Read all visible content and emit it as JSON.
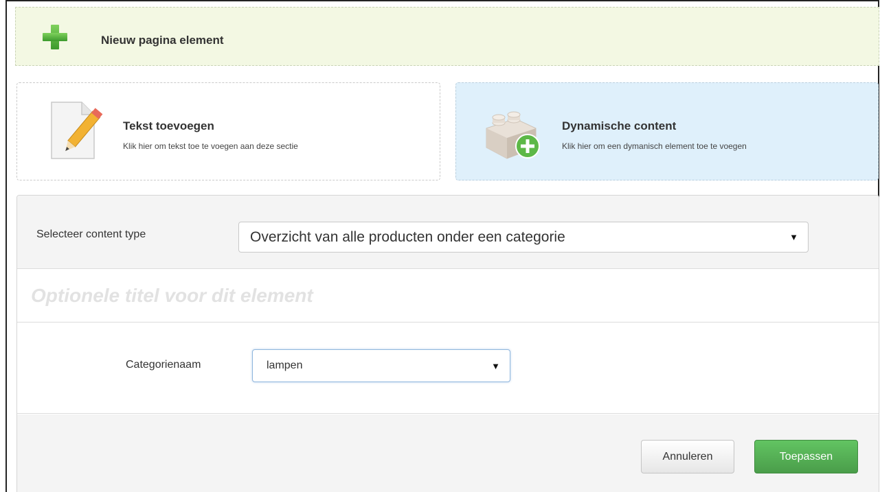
{
  "header": {
    "title": "Nieuw pagina element",
    "icon": "plus-icon",
    "accent": "#4caf3b"
  },
  "cards": {
    "text": {
      "title": "Tekst toevoegen",
      "description": "Klik hier om tekst toe te voegen aan deze sectie",
      "icon": "pencil-document-icon"
    },
    "dynamic": {
      "title": "Dynamische content",
      "description": "Klik hier om een dymanisch element toe te voegen",
      "icon": "lego-brick-add-icon",
      "selected_background": "#dff0fb"
    }
  },
  "form": {
    "content_type_label": "Selecteer content type",
    "content_type_value": "Overzicht van alle producten onder een categorie",
    "title_placeholder": "Optionele titel voor dit element",
    "category_label": "Categorienaam",
    "category_value": "lampen"
  },
  "footer": {
    "cancel_label": "Annuleren",
    "apply_label": "Toepassen",
    "apply_color": "#5cb85c"
  }
}
